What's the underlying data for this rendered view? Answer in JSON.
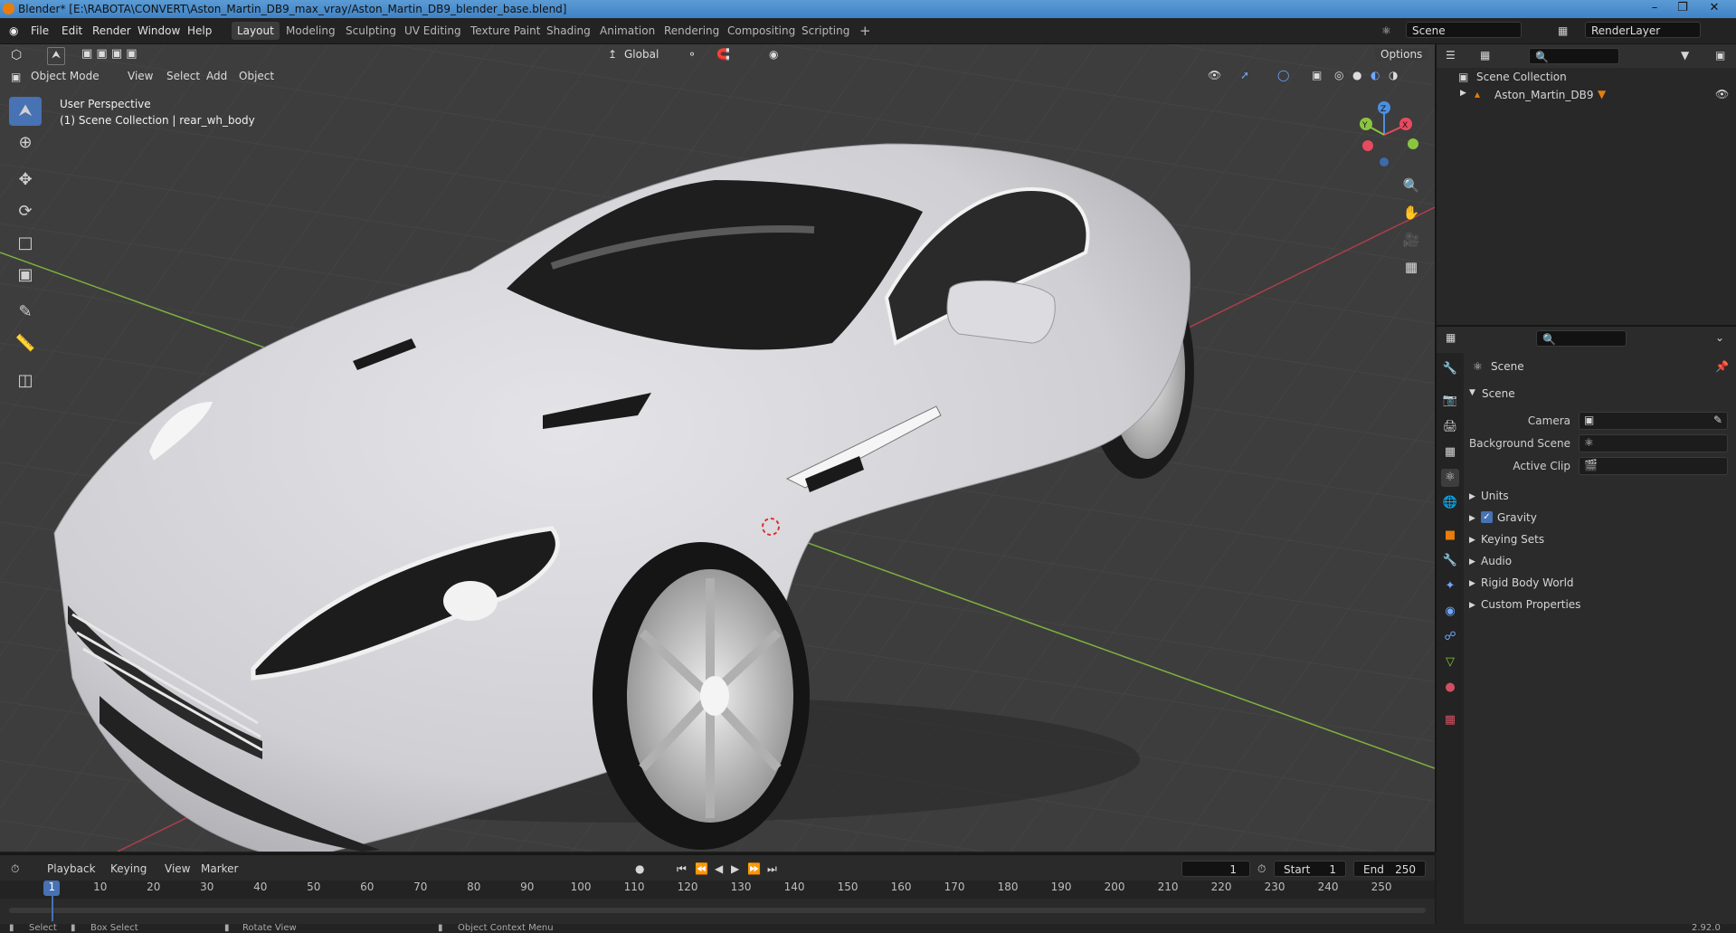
{
  "window": {
    "title": "Blender* [E:\\RABOTA\\CONVERT\\Aston_Martin_DB9_max_vray/Aston_Martin_DB9_blender_base.blend]"
  },
  "menu": {
    "items": [
      "File",
      "Edit",
      "Render",
      "Window",
      "Help"
    ],
    "workspaces": [
      "Layout",
      "Modeling",
      "Sculpting",
      "UV Editing",
      "Texture Paint",
      "Shading",
      "Animation",
      "Rendering",
      "Compositing",
      "Scripting"
    ],
    "active_workspace": "Layout",
    "add_workspace": "+",
    "scene": "Scene",
    "render_layer": "RenderLayer"
  },
  "viewport": {
    "mode": "Object Mode",
    "menus": [
      "View",
      "Select",
      "Add",
      "Object"
    ],
    "orientation": "Global",
    "options": "Options",
    "overlay_line1": "User Perspective",
    "overlay_line2": "(1) Scene Collection | rear_wh_body",
    "gizmo_axes": {
      "x": "X",
      "y": "Y",
      "z": "Z"
    }
  },
  "outliner": {
    "root": "Scene Collection",
    "items": [
      {
        "label": "Aston_Martin_DB9"
      }
    ]
  },
  "properties": {
    "context": "Scene",
    "panel": "Scene",
    "camera_label": "Camera",
    "background_scene_label": "Background Scene",
    "active_clip_label": "Active Clip",
    "sections": [
      "Units",
      "Gravity",
      "Keying Sets",
      "Audio",
      "Rigid Body World",
      "Custom Properties"
    ],
    "gravity_checked": true
  },
  "timeline": {
    "menus": [
      "Playback",
      "Keying",
      "View",
      "Marker"
    ],
    "current_frame": "1",
    "start_label": "Start",
    "start": "1",
    "end_label": "End",
    "end": "250",
    "ticks": [
      "1",
      "10",
      "20",
      "30",
      "40",
      "50",
      "60",
      "70",
      "80",
      "90",
      "100",
      "110",
      "120",
      "130",
      "140",
      "150",
      "160",
      "170",
      "180",
      "190",
      "200",
      "210",
      "220",
      "230",
      "240",
      "250"
    ]
  },
  "statusbar": {
    "select": "Select",
    "box_select": "Box Select",
    "rotate_view": "Rotate View",
    "context_menu": "Object Context Menu",
    "version": "2.92.0"
  },
  "colors": {
    "accent": "#4772b3",
    "x_axis": "#e84a5f",
    "y_axis": "#8bc53f",
    "z_axis": "#4a90e2",
    "car_body": "#d8d8dc"
  }
}
